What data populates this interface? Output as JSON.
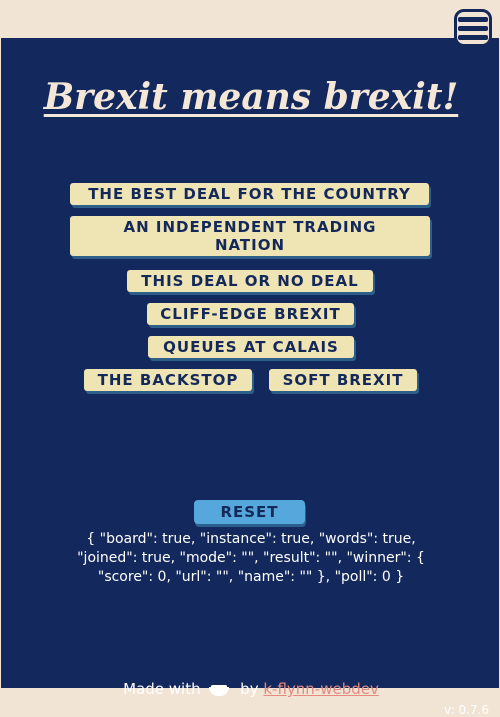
{
  "title": "Brexit means brexit!",
  "buttons": [
    "THE BEST DEAL FOR THE COUNTRY",
    "AN INDEPENDENT TRADING NATION",
    "THIS DEAL OR NO DEAL",
    "CLIFF-EDGE BREXIT",
    "QUEUES AT CALAIS",
    "THE BACKSTOP",
    "SOFT BREXIT"
  ],
  "reset_label": "RESET",
  "state_text": "{ \"board\": true, \"instance\": true, \"words\": true, \"joined\": true, \"mode\": \"\", \"result\": \"\", \"winner\": { \"score\": 0, \"url\": \"\", \"name\": \"\" }, \"poll\": 0 }",
  "footer": {
    "made_with": "Made with",
    "by": "by",
    "author": "k-flynn-webdev",
    "icon": "coffee-cup-icon"
  },
  "version": "v: 0.7.6",
  "colors": {
    "background": "#13285c",
    "topbar": "#f2e4d4",
    "button": "#eee4b4",
    "reset": "#56a8dc",
    "link": "#e58a80"
  }
}
